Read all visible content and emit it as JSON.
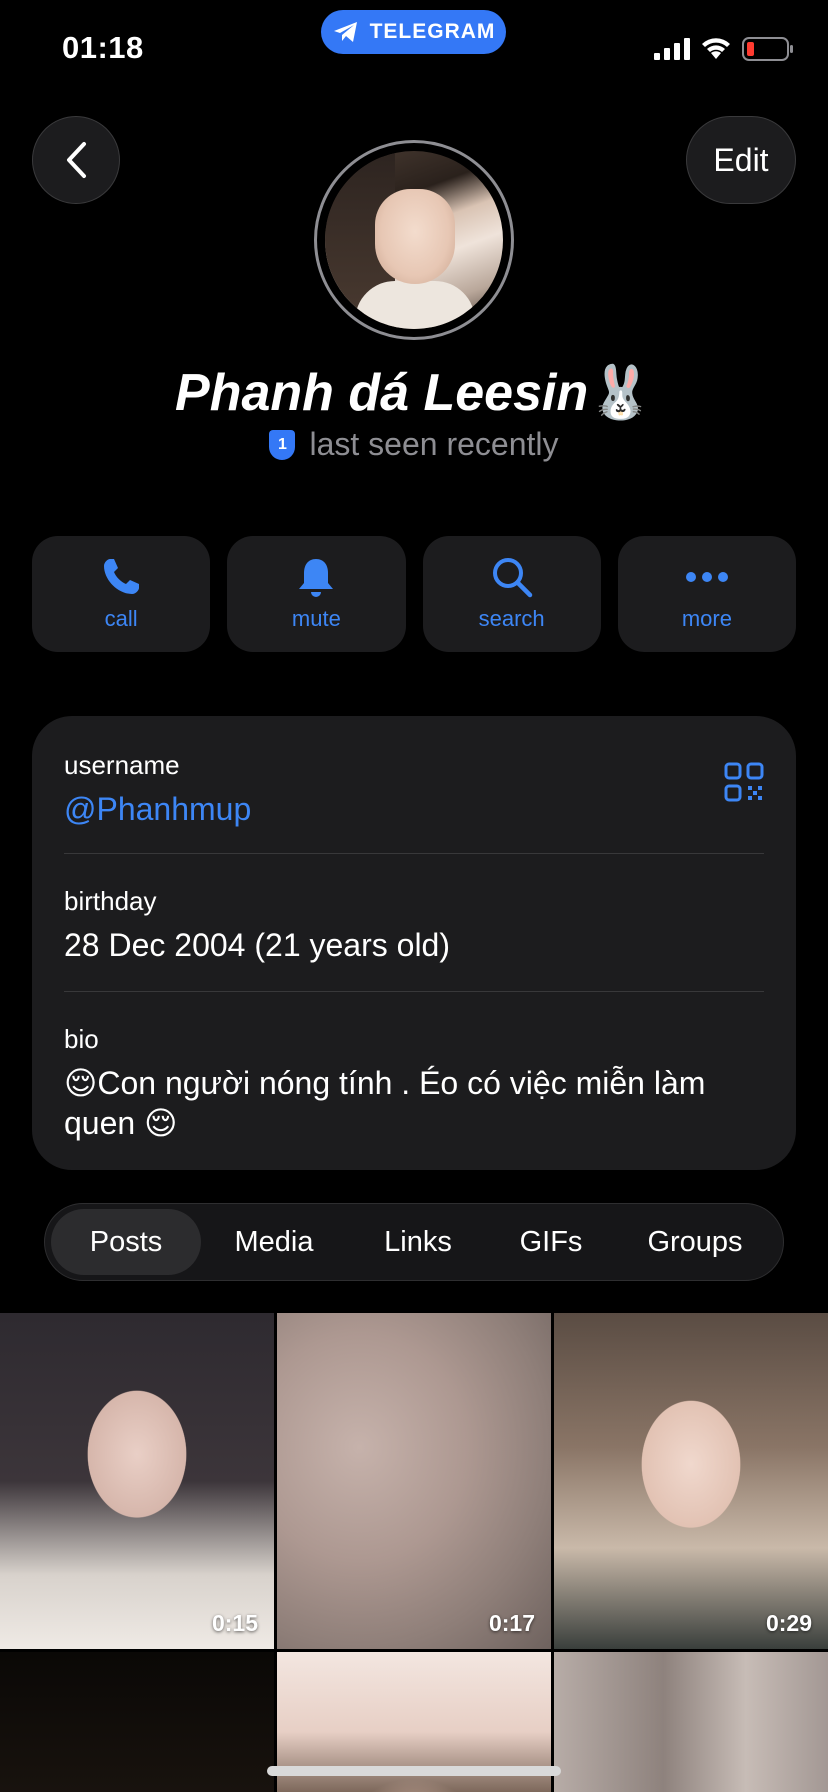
{
  "status_bar": {
    "time": "01:18",
    "app_pill": "TELEGRAM"
  },
  "header": {
    "edit_label": "Edit"
  },
  "profile": {
    "name": "Phanh dá Leesin",
    "name_emoji": "🐰",
    "badge_number": "1",
    "last_seen": "last seen recently"
  },
  "actions": [
    {
      "label": "call",
      "icon": "phone-icon"
    },
    {
      "label": "mute",
      "icon": "bell-icon"
    },
    {
      "label": "search",
      "icon": "search-icon"
    },
    {
      "label": "more",
      "icon": "more-icon"
    }
  ],
  "info": {
    "username_label": "username",
    "username_value": "@Phanhmup",
    "birthday_label": "birthday",
    "birthday_value": "28 Dec 2004 (21 years old)",
    "bio_label": "bio",
    "bio_value": "😌Con người nóng tính . Éo có việc miễn làm quen 😌"
  },
  "tabs": [
    {
      "label": "Posts",
      "active": true
    },
    {
      "label": "Media"
    },
    {
      "label": "Links"
    },
    {
      "label": "GIFs"
    },
    {
      "label": "Groups"
    }
  ],
  "media": [
    {
      "duration": "0:15"
    },
    {
      "duration": "0:17"
    },
    {
      "duration": "0:29"
    }
  ],
  "colors": {
    "accent": "#3d86f5",
    "telegram_blue": "#3478f6",
    "card_bg": "#1c1c1e",
    "battery_low": "#ff3b30"
  }
}
